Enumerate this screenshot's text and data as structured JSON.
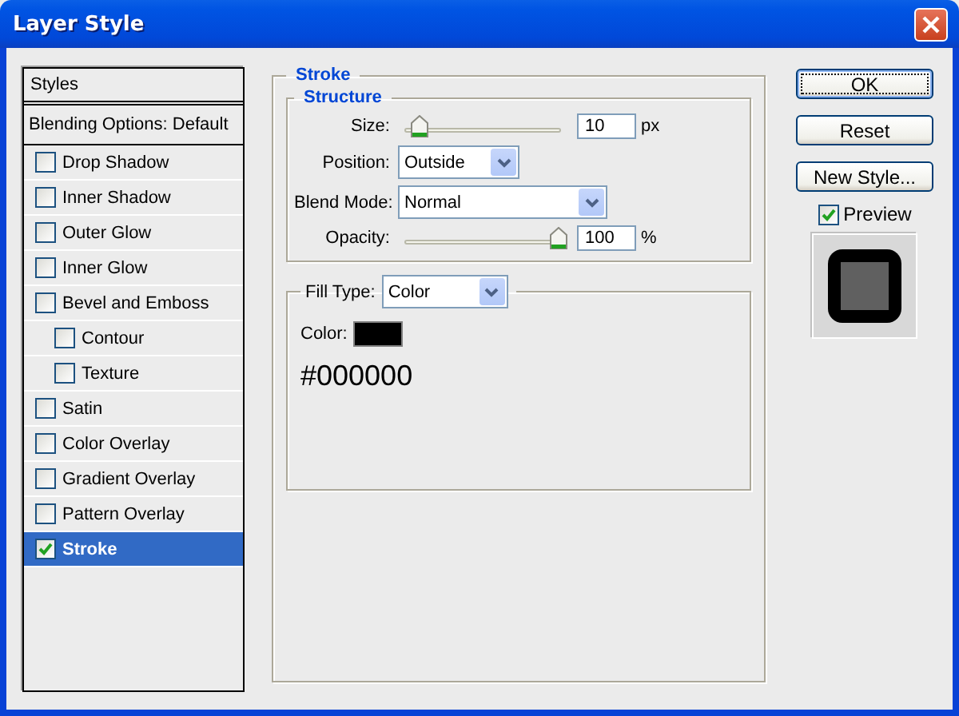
{
  "window": {
    "title": "Layer Style"
  },
  "styles_list": {
    "items": [
      {
        "kind": "title",
        "label": "Styles",
        "selected": false
      },
      {
        "kind": "header",
        "label": "Blending Options: Default",
        "selected": false
      },
      {
        "kind": "check",
        "label": "Drop Shadow",
        "checked": false,
        "selected": false
      },
      {
        "kind": "check",
        "label": "Inner Shadow",
        "checked": false,
        "selected": false
      },
      {
        "kind": "check",
        "label": "Outer Glow",
        "checked": false,
        "selected": false
      },
      {
        "kind": "check",
        "label": "Inner Glow",
        "checked": false,
        "selected": false
      },
      {
        "kind": "check",
        "label": "Bevel and Emboss",
        "checked": false,
        "selected": false,
        "children": [
          {
            "kind": "check",
            "label": "Contour",
            "checked": false,
            "selected": false
          },
          {
            "kind": "check",
            "label": "Texture",
            "checked": false,
            "selected": false
          }
        ]
      },
      {
        "kind": "check",
        "label": "Satin",
        "checked": false,
        "selected": false
      },
      {
        "kind": "check",
        "label": "Color Overlay",
        "checked": false,
        "selected": false
      },
      {
        "kind": "check",
        "label": "Gradient Overlay",
        "checked": false,
        "selected": false
      },
      {
        "kind": "check",
        "label": "Pattern Overlay",
        "checked": false,
        "selected": false
      },
      {
        "kind": "check",
        "label": "Stroke",
        "checked": true,
        "selected": true
      }
    ]
  },
  "stroke": {
    "title": "Stroke",
    "structure": {
      "title": "Structure",
      "rows": [
        {
          "kind": "slider",
          "label": "Size:",
          "level": 0.08,
          "value": "10",
          "unit": "px"
        },
        {
          "kind": "dropdown",
          "label": "Position:",
          "value": "Outside"
        },
        {
          "kind": "dropdown",
          "label": "Blend Mode:",
          "value": "Normal"
        },
        {
          "kind": "slider",
          "label": "Opacity:",
          "level": 1,
          "value": "100",
          "unit": "%"
        }
      ]
    },
    "fill": {
      "label": "Fill Type:",
      "value": "Color",
      "color_label": "Color:",
      "color": "#000000",
      "hex": "#000000"
    }
  },
  "buttons": [
    {
      "label": "OK",
      "focused": true
    },
    {
      "label": "Reset",
      "focused": false
    },
    {
      "label": "New Style...",
      "focused": false
    }
  ],
  "preview": {
    "label": "Preview",
    "checked": true
  }
}
